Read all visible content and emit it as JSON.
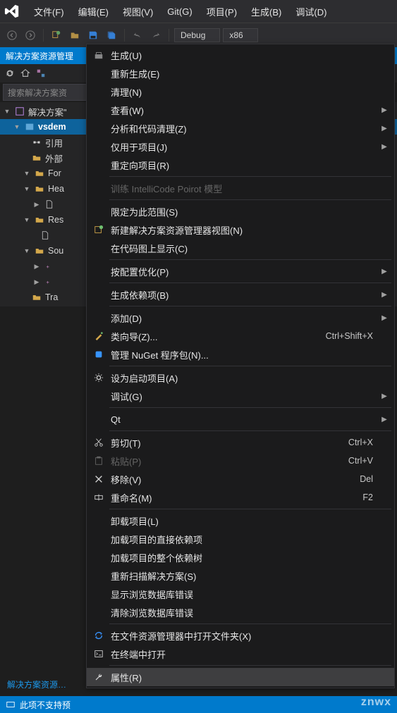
{
  "menubar": {
    "items": [
      "文件(F)",
      "编辑(E)",
      "视图(V)",
      "Git(G)",
      "项目(P)",
      "生成(B)",
      "调试(D)"
    ]
  },
  "toolbar": {
    "config": "Debug",
    "platform": "x86"
  },
  "explorer": {
    "title": "解决方案资源管理",
    "search_placeholder": "搜索解决方案资",
    "solution_label": "解决方案\"",
    "project_label": "vsdem",
    "nodes": {
      "refs": "引用",
      "ext": "外部",
      "for": "For",
      "hea": "Hea",
      "res": "Res",
      "sou": "Sou",
      "tra": "Tra"
    }
  },
  "ctx": {
    "build": "生成(U)",
    "rebuild": "重新生成(E)",
    "clean": "清理(N)",
    "view": "查看(W)",
    "analyze": "分析和代码清理(Z)",
    "projonly": "仅用于项目(J)",
    "retarget": "重定向项目(R)",
    "intellicode": "训练 IntelliCode Poirot 模型",
    "scope": "限定为此范围(S)",
    "newview": "新建解决方案资源管理器视图(N)",
    "codemap": "在代码图上显示(C)",
    "optimize": "按配置优化(P)",
    "deps": "生成依赖项(B)",
    "add": "添加(D)",
    "wizard": "类向导(Z)...",
    "wizard_keys": "Ctrl+Shift+X",
    "nuget": "管理 NuGet 程序包(N)...",
    "startup": "设为启动项目(A)",
    "debug": "调试(G)",
    "qt": "Qt",
    "cut": "剪切(T)",
    "cut_keys": "Ctrl+X",
    "paste": "粘贴(P)",
    "paste_keys": "Ctrl+V",
    "remove": "移除(V)",
    "remove_keys": "Del",
    "rename": "重命名(M)",
    "rename_keys": "F2",
    "unload": "卸载项目(L)",
    "loaddirect": "加载项目的直接依赖项",
    "loadtree": "加载项目的整个依赖树",
    "rescan": "重新扫描解决方案(S)",
    "showerr": "显示浏览数据库错误",
    "clearerr": "清除浏览数据库错误",
    "openfolder": "在文件资源管理器中打开文件夹(X)",
    "openterm": "在终端中打开",
    "props": "属性(R)"
  },
  "footer_tab": "解决方案资源…",
  "status_text": "此项不支持预",
  "watermark": "znwx"
}
